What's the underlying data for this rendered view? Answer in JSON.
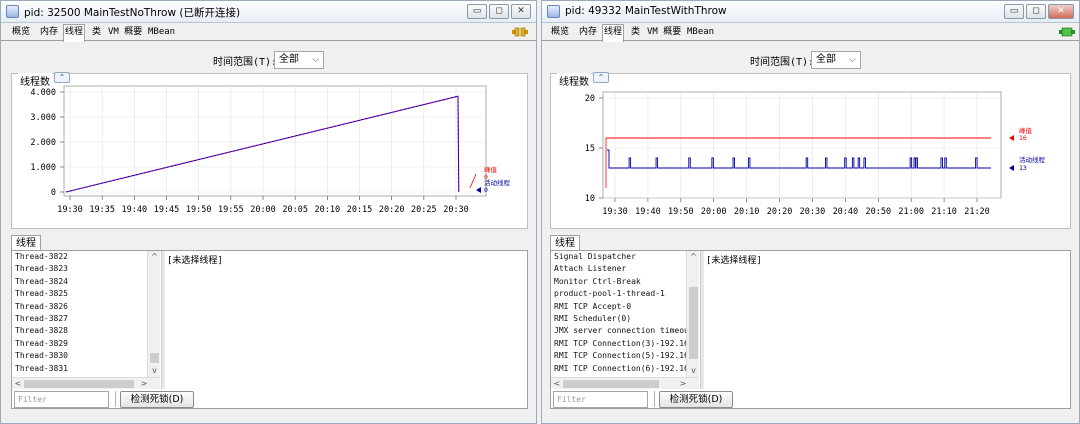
{
  "windows": [
    {
      "title": "pid: 32500 MainTestNoThrow (已断开连接)",
      "tabs": [
        "概览",
        "内存",
        "线程",
        "类",
        "VM 概要",
        "MBean"
      ],
      "selected_tab": "线程",
      "connection_status": "disconnected",
      "range_label": "时间范围(T):",
      "range_value": "全部",
      "chart_title": "线程数",
      "thread_tab": "线程",
      "threads": [
        "Thread-3822",
        "Thread-3823",
        "Thread-3824",
        "Thread-3825",
        "Thread-3826",
        "Thread-3827",
        "Thread-3828",
        "Thread-3829",
        "Thread-3830",
        "Thread-3831"
      ],
      "detail_text": "[未选择线程]",
      "filter_placeholder": "Filter",
      "deadlock_button": "检测死锁(D)",
      "chart_data": {
        "type": "line",
        "title": "线程数",
        "y_ticks": [
          "4.000",
          "3.000",
          "2.000",
          "1.000",
          "0"
        ],
        "ylim": [
          0,
          4000
        ],
        "x_ticks": [
          "19:30",
          "19:35",
          "19:40",
          "19:45",
          "19:50",
          "19:55",
          "20:00",
          "20:05",
          "20:10",
          "20:15",
          "20:20",
          "20:25",
          "20:30"
        ],
        "series": [
          {
            "name": "峰值",
            "color": "#ff0000",
            "last_value": "0"
          },
          {
            "name": "活动线程",
            "color": "#0000a0",
            "last_value": "0"
          }
        ],
        "points": [
          [
            0,
            0
          ],
          [
            1,
            3830
          ],
          [
            1.002,
            0
          ]
        ],
        "grid": true
      }
    },
    {
      "title": "pid: 49332 MainTestWithThrow",
      "tabs": [
        "概览",
        "内存",
        "线程",
        "类",
        "VM 概要",
        "MBean"
      ],
      "selected_tab": "线程",
      "connection_status": "connected",
      "range_label": "时间范围(T):",
      "range_value": "全部",
      "chart_title": "线程数",
      "thread_tab": "线程",
      "threads": [
        "Signal Dispatcher",
        "Attach Listener",
        "Monitor Ctrl-Break",
        "product-pool-1-thread-1",
        "RMI TCP Accept-0",
        "RMI Scheduler(0)",
        "JMX server connection timeout",
        "RMI TCP Connection(3)-192.168.",
        "RMI TCP Connection(5)-192.168.",
        "RMI TCP Connection(6)-192.168."
      ],
      "detail_text": "[未选择线程]",
      "filter_placeholder": "Filter",
      "deadlock_button": "检测死锁(D)",
      "chart_data": {
        "type": "line",
        "title": "线程数",
        "y_ticks": [
          "20",
          "15",
          "10"
        ],
        "ylim": [
          10,
          20
        ],
        "x_ticks": [
          "19:30",
          "19:40",
          "19:50",
          "20:00",
          "20:10",
          "20:20",
          "20:30",
          "20:40",
          "20:50",
          "21:00",
          "21:10",
          "21:20"
        ],
        "series": [
          {
            "name": "峰值",
            "color": "#ff0000",
            "last_value": "16"
          },
          {
            "name": "活动线程",
            "color": "#0000a0",
            "last_value": "13"
          }
        ],
        "grid": true
      }
    }
  ]
}
